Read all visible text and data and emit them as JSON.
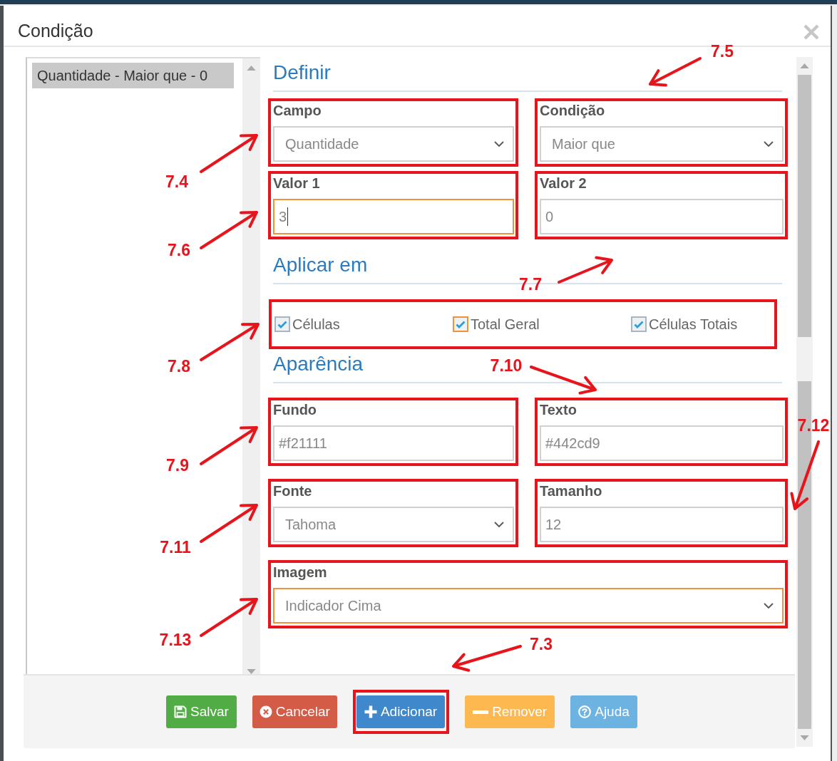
{
  "dialog": {
    "title": "Condição"
  },
  "condition_list": {
    "items": [
      {
        "label": "Quantidade - Maior que - 0",
        "selected": true
      }
    ]
  },
  "sections": [
    {
      "title": "Definir",
      "kind": "fields",
      "fields": [
        {
          "kind": "select",
          "label": "Campo",
          "value": "Quantidade",
          "focused": false,
          "highlighted": true
        },
        {
          "kind": "select",
          "label": "Condição",
          "value": "Maior que",
          "focused": false,
          "highlighted": true
        },
        {
          "kind": "input",
          "label": "Valor 1",
          "value": "3",
          "focused": true,
          "highlighted": true
        },
        {
          "kind": "input",
          "label": "Valor 2",
          "value": "0",
          "focused": false,
          "highlighted": true
        }
      ]
    },
    {
      "title": "Aplicar em",
      "kind": "checkboxes",
      "highlighted": true,
      "options": [
        {
          "label": "Células",
          "checked": true,
          "focused": false
        },
        {
          "label": "Total Geral",
          "checked": true,
          "focused": true
        },
        {
          "label": "Células Totais",
          "checked": true,
          "focused": false
        }
      ]
    },
    {
      "title": "Aparência",
      "kind": "fields",
      "fields": [
        {
          "kind": "input",
          "label": "Fundo",
          "value": "#f21111",
          "focused": false,
          "highlighted": true
        },
        {
          "kind": "input",
          "label": "Texto",
          "value": "#442cd9",
          "focused": false,
          "highlighted": true
        },
        {
          "kind": "select",
          "label": "Fonte",
          "value": "Tahoma",
          "focused": false,
          "highlighted": true
        },
        {
          "kind": "input",
          "label": "Tamanho",
          "value": "12",
          "focused": false,
          "highlighted": true
        },
        {
          "kind": "select",
          "label": "Imagem",
          "value": "Indicador Cima",
          "focused": true,
          "highlighted": true
        }
      ]
    }
  ],
  "buttons": [
    {
      "kind": "save",
      "label": "Salvar",
      "highlighted": false
    },
    {
      "kind": "cancel",
      "label": "Cancelar",
      "highlighted": false
    },
    {
      "kind": "add",
      "label": "Adicionar",
      "highlighted": true
    },
    {
      "kind": "remove",
      "label": "Remover",
      "highlighted": false
    },
    {
      "kind": "help",
      "label": "Ajuda",
      "highlighted": false
    }
  ],
  "callouts": [
    {
      "label": "7.5"
    },
    {
      "label": "7.4"
    },
    {
      "label": "7.6"
    },
    {
      "label": "7.7"
    },
    {
      "label": "7.10"
    },
    {
      "label": "7.8"
    },
    {
      "label": "7.12"
    },
    {
      "label": "7.9"
    },
    {
      "label": "7.11"
    },
    {
      "label": "7.13"
    },
    {
      "label": "7.3"
    }
  ]
}
